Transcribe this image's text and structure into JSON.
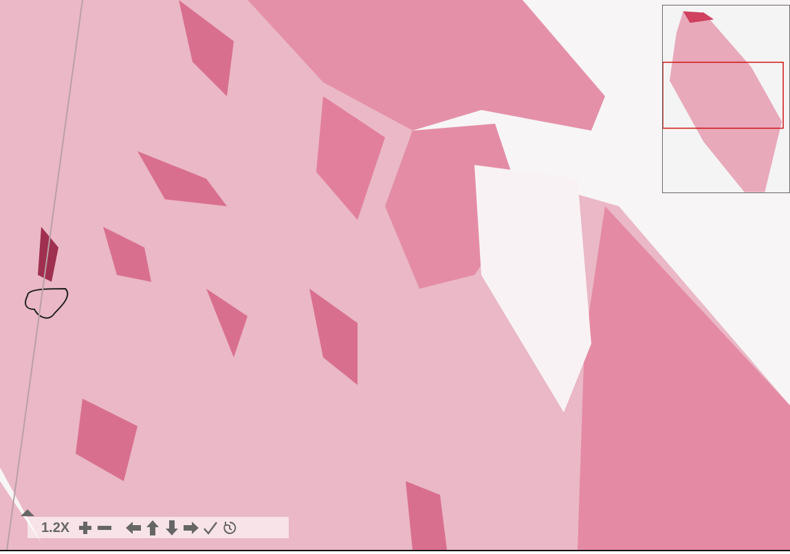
{
  "toolbar": {
    "zoom_label": "1.2X"
  }
}
